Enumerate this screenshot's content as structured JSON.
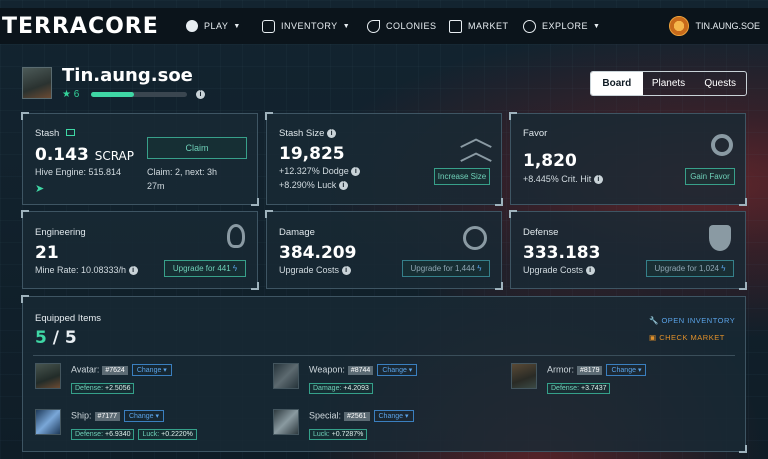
{
  "header": {
    "logo": "TERRACORE",
    "nav": [
      {
        "label": "PLAY",
        "icon": "play-icon",
        "dropdown": true
      },
      {
        "label": "INVENTORY",
        "icon": "backpack-icon",
        "dropdown": true
      },
      {
        "label": "COLONIES",
        "icon": "colonies-icon",
        "dropdown": false
      },
      {
        "label": "MARKET",
        "icon": "market-icon",
        "dropdown": false
      },
      {
        "label": "EXPLORE",
        "icon": "compass-icon",
        "dropdown": true
      }
    ],
    "username": "TIN.AUNG.SOE"
  },
  "profile": {
    "name": "Tin.aung.soe",
    "level": "6",
    "xp_progress": 0.45
  },
  "tabs": [
    "Board",
    "Planets",
    "Quests"
  ],
  "active_tab": "Board",
  "stash": {
    "title": "Stash",
    "value": "0.143",
    "unit": "SCRAP",
    "hive_engine": "Hive Engine: 515.814",
    "claim_label": "Claim",
    "claim_info": "Claim: 2, next: 3h",
    "claim_info2": "27m"
  },
  "stash_size": {
    "title": "Stash Size",
    "value": "19,825",
    "dodge": "+12.327% Dodge",
    "luck": "+8.290% Luck",
    "button": "Increase Size"
  },
  "favor": {
    "title": "Favor",
    "value": "1,820",
    "crit": "+8.445% Crit. Hit",
    "button": "Gain Favor"
  },
  "engineering": {
    "title": "Engineering",
    "value": "21",
    "rate": "Mine Rate: 10.08333/h",
    "button": "Upgrade for 441"
  },
  "damage": {
    "title": "Damage",
    "value": "384.209",
    "sub": "Upgrade Costs",
    "button": "Upgrade for 1,444"
  },
  "defense": {
    "title": "Defense",
    "value": "333.183",
    "sub": "Upgrade Costs",
    "button": "Upgrade for 1,024"
  },
  "equipped": {
    "title": "Equipped Items",
    "count_a": "5",
    "count_sep": " / ",
    "count_b": "5",
    "open_inventory": "OPEN INVENTORY",
    "check_market": "CHECK MARKET",
    "change_label": "Change",
    "items": [
      {
        "slot": "Avatar:",
        "id": "#7624",
        "stats": [
          {
            "k": "Defense:",
            "v": "+2.5056"
          }
        ]
      },
      {
        "slot": "Weapon:",
        "id": "#8744",
        "stats": [
          {
            "k": "Damage:",
            "v": "+4.2093"
          }
        ]
      },
      {
        "slot": "Armor:",
        "id": "#8179",
        "stats": [
          {
            "k": "Defense:",
            "v": "+3.7437"
          }
        ]
      },
      {
        "slot": "Ship:",
        "id": "#7177",
        "stats": [
          {
            "k": "Defense:",
            "v": "+6.9340"
          },
          {
            "k": "Luck:",
            "v": "+0.2220%"
          }
        ]
      },
      {
        "slot": "Special:",
        "id": "#2561",
        "stats": [
          {
            "k": "Luck:",
            "v": "+0.7287%"
          }
        ]
      }
    ]
  },
  "colors": {
    "accent": "#3fd7a5",
    "link_blue": "#5aa3e8",
    "market_orange": "#e0902a"
  }
}
